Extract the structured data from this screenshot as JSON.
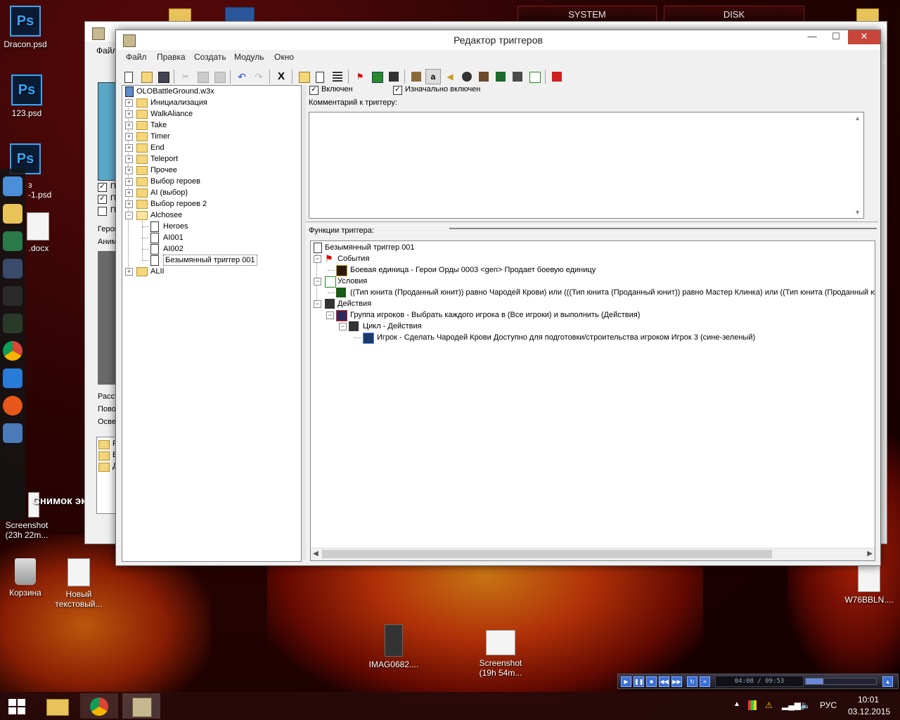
{
  "window": {
    "title": "Редактор триггеров",
    "menu": [
      "Файл",
      "Правка",
      "Создать",
      "Модуль",
      "Окно"
    ],
    "controls": {
      "minimize": "—",
      "maximize": "☐",
      "close": "✕"
    }
  },
  "tree": {
    "root": "OLOBattleGround.w3x",
    "folders": [
      "Инициализация",
      "WalkAliance",
      "Take",
      "Timer",
      "End",
      "Teleport",
      "Прочее",
      "Выбор героев",
      "AI (выбор)",
      "Выбор героев 2",
      "Alchosee"
    ],
    "alchosee_children": [
      "Heroes",
      "AI001",
      "AI002",
      "Безымянный триггер 001"
    ],
    "last_folder": "ALII"
  },
  "trigger": {
    "enabled_label": "Включен",
    "enabled": true,
    "initially_enabled_label": "Изначально включен",
    "initially_enabled": true,
    "comment_label": "Комментарий к триггеру:",
    "comment": "",
    "functions_label": "Функции триггера:"
  },
  "functions": {
    "name": "Безымянный триггер 001",
    "events_label": "События",
    "event": "Боевая единица - Герои Орды 0003 <gen> Продает боевую единицу",
    "conditions_label": "Условия",
    "condition": "((Тип юнита (Проданный юнит)) равно Чародей Крови) или (((Тип юнита (Проданный юнит)) равно Мастер Клинка) или ((Тип юнита (Проданный юнит",
    "actions_label": "Действия",
    "action_group": "Группа игроков - Выбрать каждого игрока в (Все игроки) и выполнить (Действия)",
    "loop_label": "Цикл - Действия",
    "loop_action": "Игрок - Сделать Чародей Крови Доступно для подготовки/строительства игроком Игрок 3 (сине-зеленый)"
  },
  "background_window": {
    "menu_fragment": "Файл",
    "side_labels": [
      "П",
      "П",
      "П",
      "Герои",
      "Аним",
      "Расст",
      "Пово",
      "Осве"
    ],
    "folder_labels": [
      "F",
      "E",
      "Д"
    ]
  },
  "desktop": {
    "icons": [
      {
        "label": "Dracon.psd",
        "icon": "photoshop-icon"
      },
      {
        "label": "123.psd",
        "icon": "photoshop-icon"
      },
      {
        "label": "-1.psd",
        "icon": "photoshop-icon"
      },
      {
        "label": ".docx",
        "icon": "document-icon"
      },
      {
        "label": "Screenshot\n(23h 22m...",
        "icon": "image-icon"
      },
      {
        "label": "Корзина",
        "icon": "recycle-bin-icon"
      },
      {
        "label": "Новый\nтекстовый...",
        "icon": "text-file-icon"
      },
      {
        "label": "IMAG0682....",
        "icon": "image-icon"
      },
      {
        "label": "Screenshot\n(19h 54m...",
        "icon": "image-icon"
      },
      {
        "label": "W76BBLN....",
        "icon": "text-file-icon"
      }
    ],
    "partial_label": "з",
    "tooltip": "Снимок экрана",
    "gadgets": [
      "SYSTEM",
      "DISK"
    ]
  },
  "media_player": {
    "time": "04:08 / 09:53"
  },
  "taskbar": {
    "language": "РУС",
    "time": "10:01",
    "date": "03.12.2015"
  },
  "colors": {
    "accent": "#3b6fd6",
    "close": "#c7463a",
    "desktop": "#2a0303"
  }
}
